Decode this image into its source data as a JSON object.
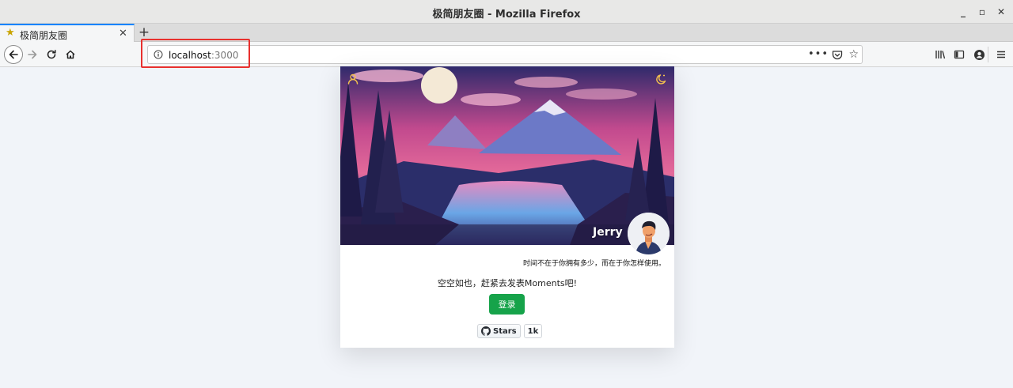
{
  "window": {
    "title": "极简朋友圈 - Mozilla Firefox",
    "min_glyph": "_",
    "max_glyph": "▫",
    "close_glyph": "✕"
  },
  "tabs": [
    {
      "label": "极简朋友圈",
      "icon": "star-icon"
    }
  ],
  "tabbar": {
    "close_glyph": "✕",
    "new_tab_glyph": "+"
  },
  "urlbar": {
    "host": "localhost",
    "port": ":3000",
    "more_glyph": "•••",
    "bookmark_glyph": "☆"
  },
  "page": {
    "username": "Jerry",
    "motto": "时间不在于你拥有多少，而在于你怎样使用。",
    "empty_message": "空空如也，赶紧去发表Moments吧!",
    "login_label": "登录",
    "github": {
      "stars_label": "Stars",
      "count": "1k"
    }
  },
  "colors": {
    "accent_green": "#16a34a",
    "firefox_blue": "#0a84ff",
    "highlight_red": "#e8302e",
    "background": "#f1f4f9"
  }
}
